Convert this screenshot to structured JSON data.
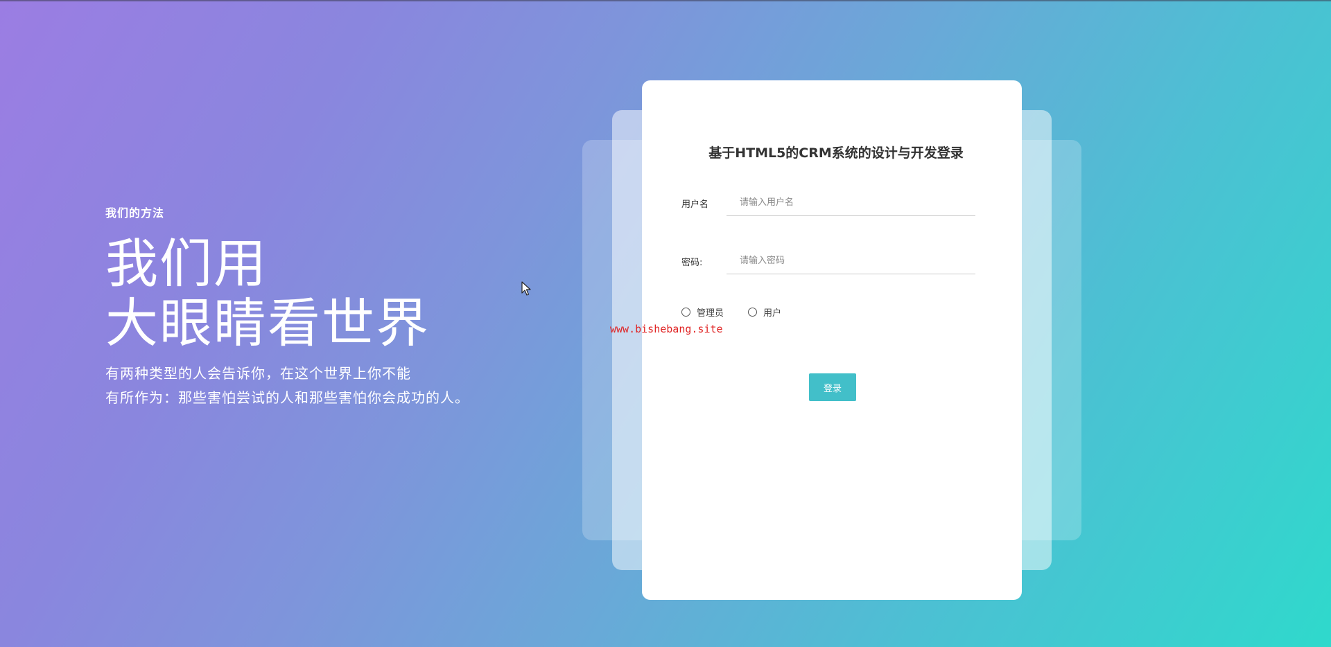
{
  "hero": {
    "kicker": "我们的方法",
    "title_line1": "我们用",
    "title_line2": "大眼睛看世界",
    "desc_line1": "有两种类型的人会告诉你，在这个世界上你不能",
    "desc_line2": "有所作为：那些害怕尝试的人和那些害怕你会成功的人。"
  },
  "login": {
    "title": "基于HTML5的CRM系统的设计与开发登录",
    "username_label": "用户名",
    "username_placeholder": "请输入用户名",
    "username_value": "",
    "password_label": "密码:",
    "password_placeholder": "请输入密码",
    "password_value": "",
    "roles": [
      "管理员",
      "用户"
    ],
    "submit_label": "登录"
  },
  "watermark": "www.bishebang.site",
  "colors": {
    "accent_button": "#42bfc9",
    "watermark": "#e02424",
    "gradient_start": "#9b7de3",
    "gradient_end": "#2fd9cc"
  },
  "icons": [
    "mouse-cursor-icon",
    "radio-button-icon"
  ]
}
